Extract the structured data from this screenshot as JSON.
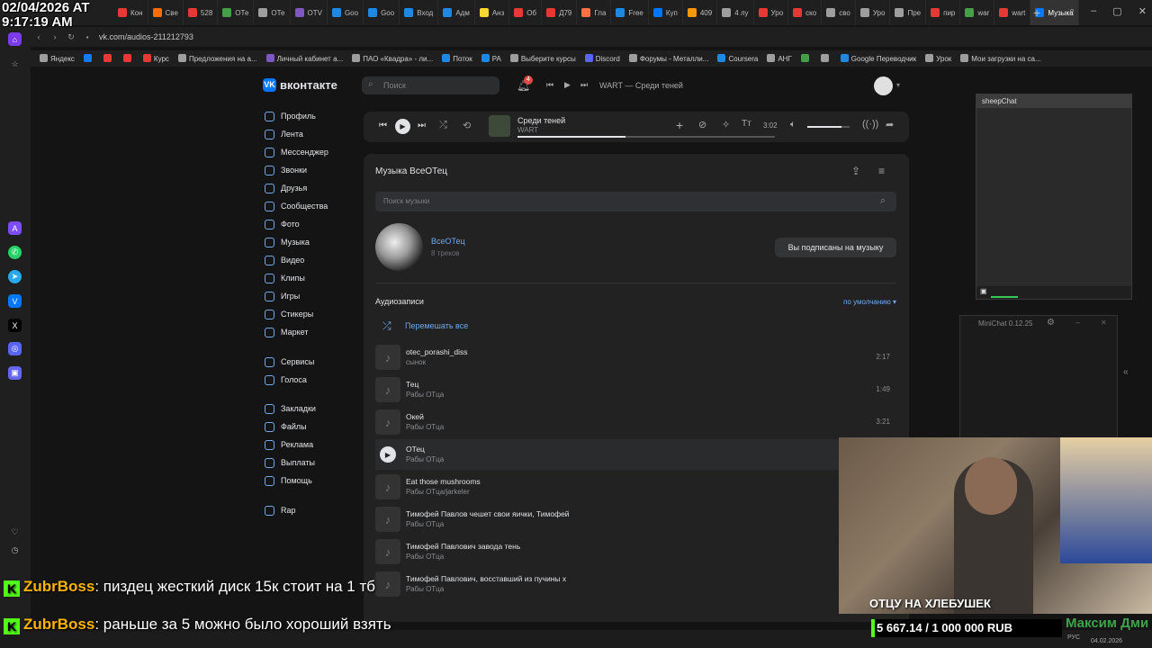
{
  "overlay": {
    "date": "02/04/2026 AT",
    "time": "9:17:19 AM"
  },
  "browser": {
    "tabs": [
      {
        "label": "Кон",
        "color": "#e53935"
      },
      {
        "label": "Све",
        "color": "#ff6d00"
      },
      {
        "label": "528",
        "color": "#e53935"
      },
      {
        "label": "ОТе",
        "color": "#43a047"
      },
      {
        "label": "ОТе",
        "color": "#9e9e9e"
      },
      {
        "label": "ОТV",
        "color": "#7e57c2"
      },
      {
        "label": "Goo",
        "color": "#1e88e5"
      },
      {
        "label": "Goo",
        "color": "#1e88e5"
      },
      {
        "label": "Вход",
        "color": "#1e88e5"
      },
      {
        "label": "Адм",
        "color": "#1e88e5"
      },
      {
        "label": "Анз",
        "color": "#fdd835"
      },
      {
        "label": "Об",
        "color": "#e53935"
      },
      {
        "label": "Д79",
        "color": "#e53935"
      },
      {
        "label": "Гла",
        "color": "#ff7043"
      },
      {
        "label": "Free",
        "color": "#1e88e5"
      },
      {
        "label": "Куп",
        "color": "#0077ff"
      },
      {
        "label": "409",
        "color": "#ff9800"
      },
      {
        "label": "4 лу",
        "color": "#9e9e9e"
      },
      {
        "label": "Уро",
        "color": "#e53935"
      },
      {
        "label": "ско",
        "color": "#e53935"
      },
      {
        "label": "сво",
        "color": "#9e9e9e"
      },
      {
        "label": "Уро",
        "color": "#9e9e9e"
      },
      {
        "label": "Пре",
        "color": "#9e9e9e"
      },
      {
        "label": "пир",
        "color": "#e53935"
      },
      {
        "label": "war",
        "color": "#43a047"
      },
      {
        "label": "wart",
        "color": "#e53935"
      },
      {
        "label": "Музыка",
        "color": "#0077ff",
        "active": true
      }
    ],
    "url": "vk.com/audios-211212793",
    "bookmarks": [
      {
        "label": "Яндекс",
        "color": "#9e9e9e"
      },
      {
        "label": "",
        "color": "#1877f2"
      },
      {
        "label": "",
        "color": "#e53935"
      },
      {
        "label": "",
        "color": "#e53935"
      },
      {
        "label": "Курс",
        "color": "#e53935"
      },
      {
        "label": "Предложения на а...",
        "color": "#9e9e9e"
      },
      {
        "label": "Личный кабинет а...",
        "color": "#7e57c2"
      },
      {
        "label": "ПАО «Квадра» - ли...",
        "color": "#9e9e9e"
      },
      {
        "label": "Поток",
        "color": "#1e88e5"
      },
      {
        "label": "PA",
        "color": "#1e88e5"
      },
      {
        "label": "Выберите курсы",
        "color": "#9e9e9e"
      },
      {
        "label": "Discord",
        "color": "#5865f2"
      },
      {
        "label": "Форумы - Металли...",
        "color": "#9e9e9e"
      },
      {
        "label": "Coursera",
        "color": "#1e88e5"
      },
      {
        "label": "АНГ",
        "color": "#9e9e9e"
      },
      {
        "label": "",
        "color": "#43a047"
      },
      {
        "label": "",
        "color": "#9e9e9e"
      },
      {
        "label": "Google Переводчик",
        "color": "#1e88e5"
      },
      {
        "label": "Урок",
        "color": "#9e9e9e"
      },
      {
        "label": "Мои загрузки на са...",
        "color": "#9e9e9e"
      }
    ]
  },
  "vk": {
    "logo_text": "вконтакте",
    "logo_mark": "VK",
    "search_placeholder": "Поиск",
    "notif_count": "4",
    "header_track": "WART — Среди теней",
    "nav": [
      "Профиль",
      "Лента",
      "Мессенджер",
      "Звонки",
      "Друзья",
      "Сообщества",
      "Фото",
      "Музыка",
      "Видео",
      "Клипы",
      "Игры",
      "Стикеры",
      "Маркет",
      "Сервисы",
      "Голоса",
      "Закладки",
      "Файлы",
      "Реклама",
      "Выплаты",
      "Помощь",
      "Rap"
    ],
    "player": {
      "title": "Среди теней",
      "artist": "WART",
      "time": "3:02",
      "progress": 0.42,
      "volume": 0.8
    },
    "music": {
      "heading": "Музыка ВсеОТец",
      "search_placeholder": "Поиск музыки",
      "owner_name": "ВсеОТец",
      "owner_tracks": "8 треков",
      "subscribe_label": "Вы подписаны на музыку",
      "section_title": "Аудиозаписи",
      "sort_label": "по умолчанию",
      "shuffle_label": "Перемешать все",
      "tracks": [
        {
          "title": "otec_porashi_diss",
          "artist": "сынок",
          "duration": "2:17"
        },
        {
          "title": "Тец",
          "artist": "Рабы ОТца",
          "duration": "1:49"
        },
        {
          "title": "Окей",
          "artist": "Рабы ОТца",
          "duration": "3:21"
        },
        {
          "title": "ОТец",
          "artist": "Рабы ОТца",
          "duration": ""
        },
        {
          "title": "Eat those mushrooms",
          "artist": "Рабы ОТца/jarkeler",
          "duration": ""
        },
        {
          "title": "Тимофей Павлов чешет свои яички, Тимофей",
          "artist": "Рабы ОТца",
          "duration": ""
        },
        {
          "title": "Тимофей Павлович завода тень",
          "artist": "Рабы ОТца",
          "duration": ""
        },
        {
          "title": "Тимофей Павлович, восставший из пучины х",
          "artist": "Рабы ОТца",
          "duration": ""
        }
      ]
    }
  },
  "widgets": {
    "sheepchat_title": "sheepChat",
    "minichat_title": "MiniChat 0.12.25"
  },
  "stream": {
    "messages": [
      {
        "user": "ZubrBoss",
        "text": ": пиздец жесткий диск 15к стоит на 1 тб"
      },
      {
        "user": "ZubrBoss",
        "text": ": раньше за 5 можно было хороший взять"
      }
    ],
    "webcam_caption": "ОТЦУ НА ХЛЕБУШЕК",
    "goal": "5 667.14 / 1 000 000 RUB",
    "goal_name": "Максим Дми",
    "clock_date": "04.02.2026",
    "lang": "РУС"
  }
}
